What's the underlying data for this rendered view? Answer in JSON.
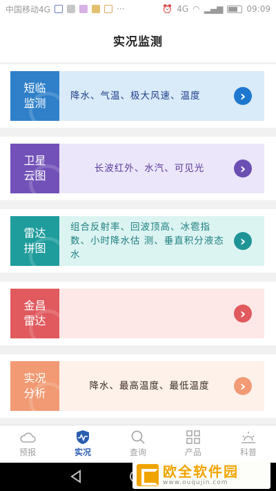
{
  "status_bar": {
    "carrier": "中国移动4G",
    "time": "09:09",
    "signal_label": "4G"
  },
  "header": {
    "title": "实况监测"
  },
  "cards": [
    {
      "badge": "短临监测",
      "text": "降水、气温、极大风速、温度",
      "badge_color": "#2f80c9",
      "body_bg": "#d9ebf8",
      "text_color": "#1f3e8a",
      "arrow_color": "#1e77cf",
      "align": "left"
    },
    {
      "badge": "卫星云图",
      "text": "长波红外、水汽、可见光",
      "badge_color": "#7252b8",
      "body_bg": "#ece6fb",
      "text_color": "#5a3b9a",
      "arrow_color": "#6b4fb3",
      "align": "center"
    },
    {
      "badge": "雷达拼图",
      "text": "组合反射率、回波顶高、冰雹指数、小时降水估 测、垂直积分液态水",
      "badge_color": "#1f9c9c",
      "body_bg": "#dcf4f1",
      "text_color": "#1f7f82",
      "arrow_color": "#1f9497",
      "align": "left"
    },
    {
      "badge": "金昌雷达",
      "text": "",
      "badge_color": "#e05a5e",
      "body_bg": "#fde7e7",
      "text_color": "#b23b3f",
      "arrow_color": "#e05a5e",
      "align": "left"
    },
    {
      "badge": "实况分析",
      "text": "降水、最高温度、最低温度",
      "badge_color": "#f19a73",
      "body_bg": "#fdf1ea",
      "text_color": "#3b2a22",
      "arrow_color": "#f19a73",
      "align": "center"
    }
  ],
  "tabs": [
    {
      "label": "预报",
      "icon": "cloud-icon",
      "active": false
    },
    {
      "label": "实况",
      "icon": "shield-wave-icon",
      "active": true
    },
    {
      "label": "查询",
      "icon": "search-icon",
      "active": false
    },
    {
      "label": "产品",
      "icon": "grid-icon",
      "active": false
    },
    {
      "label": "科普",
      "icon": "sunrise-icon",
      "active": false
    }
  ],
  "watermark": {
    "title": "欧全软件园",
    "subtitle": "www.ouqujin.com"
  },
  "colors": {
    "active_tab": "#2a5db0",
    "inactive_tab": "#9f9f9f"
  }
}
